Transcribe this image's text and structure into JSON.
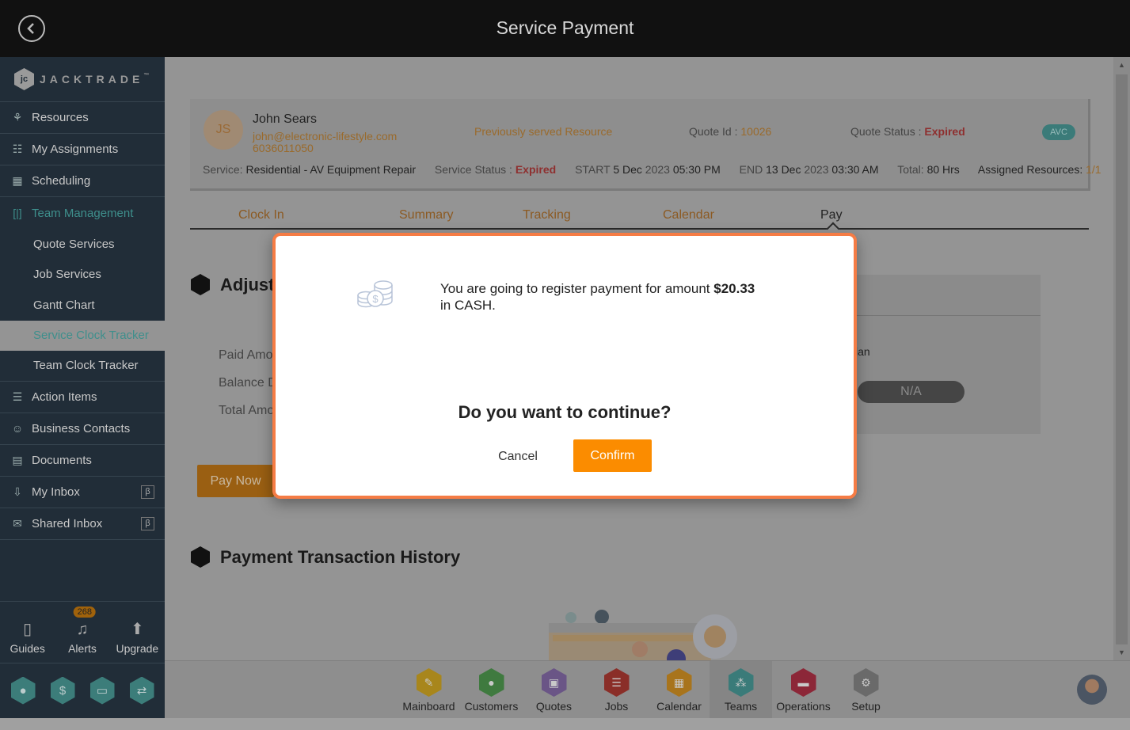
{
  "header": {
    "title": "Service Payment",
    "back_icon": "back-circle-icon"
  },
  "brand": {
    "logo_text": "JACKTRADE",
    "trademark": "™"
  },
  "sidebar": {
    "items": [
      {
        "label": "Resources",
        "icon": "resources-icon"
      },
      {
        "label": "My Assignments",
        "icon": "assignments-icon"
      },
      {
        "label": "Scheduling",
        "icon": "calendar-clock-icon"
      },
      {
        "label": "Team Management",
        "icon": "team-bracket-icon",
        "active": true
      }
    ],
    "sub_items": [
      {
        "label": "Quote Services"
      },
      {
        "label": "Job Services"
      },
      {
        "label": "Gantt Chart"
      },
      {
        "label": "Service Clock Tracker",
        "selected": true
      },
      {
        "label": "Team Clock Tracker"
      }
    ],
    "items2": [
      {
        "label": "Action Items",
        "icon": "clipboard-icon"
      },
      {
        "label": "Business Contacts",
        "icon": "contact-book-icon"
      },
      {
        "label": "Documents",
        "icon": "document-icon"
      },
      {
        "label": "My Inbox",
        "icon": "inbox-icon",
        "badge": "β"
      },
      {
        "label": "Shared Inbox",
        "icon": "mail-icon",
        "badge": "β"
      }
    ],
    "bottom": [
      {
        "label": "Guides",
        "icon": "book-icon"
      },
      {
        "label": "Alerts",
        "icon": "bell-icon",
        "badge": "268"
      },
      {
        "label": "Upgrade",
        "icon": "arrow-up-icon"
      }
    ],
    "hex_buttons": [
      "user-icon",
      "dollar-icon",
      "money-icon",
      "workflow-icon"
    ]
  },
  "service_card": {
    "initials": "JS",
    "name": "John Sears",
    "email": "john@electronic-lifestyle.com",
    "phone": "6036011050",
    "resource_note": "Previously served Resource",
    "quote_id_label": "Quote Id : ",
    "quote_id": "10026",
    "quote_status_label": "Quote Status : ",
    "quote_status": "Expired",
    "tag": "AVC",
    "service_label": "Service: ",
    "service": "Residential - AV Equipment Repair",
    "service_status_label": "Service Status : ",
    "service_status": "Expired",
    "start_label": "START ",
    "start_day": "5 Dec",
    "start_year": "2023",
    "start_time": "05:30 PM",
    "end_label": "END ",
    "end_day": "13 Dec",
    "end_year": "2023",
    "end_time": "03:30 AM",
    "total_label": "Total: ",
    "total": "80 Hrs",
    "assigned_label": "Assigned Resources: ",
    "assigned": "1/1"
  },
  "tabs": [
    {
      "label": "Clock In"
    },
    {
      "label": "Summary"
    },
    {
      "label": "Tracking"
    },
    {
      "label": "Calendar"
    },
    {
      "label": "Pay",
      "active": true
    }
  ],
  "adjust_section": {
    "title": "Adjust",
    "labels": [
      "Paid Amo",
      "Balance D",
      "Total Amo"
    ],
    "pay_now": "Pay Now",
    "right_panel_text": "ian",
    "right_panel_value": "N/A"
  },
  "history_section": {
    "title": "Payment Transaction History"
  },
  "modal": {
    "icon": "coins-dollar-icon",
    "message_prefix": "You are going to register payment for amount ",
    "amount": "$20.33",
    "message_suffix": " in CASH.",
    "question": "Do you want to continue?",
    "cancel": "Cancel",
    "confirm": "Confirm"
  },
  "bottom_nav": [
    {
      "label": "Mainboard",
      "color": "#a8861c",
      "icon": "mainboard-icon"
    },
    {
      "label": "Customers",
      "color": "#3f7a3f",
      "icon": "customer-icon"
    },
    {
      "label": "Quotes",
      "color": "#6a5586",
      "icon": "quotes-icon"
    },
    {
      "label": "Jobs",
      "color": "#8a2e28",
      "icon": "jobs-list-icon"
    },
    {
      "label": "Calendar",
      "color": "#a8741c",
      "icon": "calendar-icon"
    },
    {
      "label": "Teams",
      "color": "#3a7b79",
      "icon": "teams-icon",
      "active": true
    },
    {
      "label": "Operations",
      "color": "#8c2738",
      "icon": "briefcase-icon"
    },
    {
      "label": "Setup",
      "color": "#6a6a6a",
      "icon": "gear-icon"
    }
  ],
  "colors": {
    "accent": "#fb8c00",
    "modal_border": "#f57c45",
    "teal": "#3e8f8c",
    "expired": "#8e2f2f"
  }
}
